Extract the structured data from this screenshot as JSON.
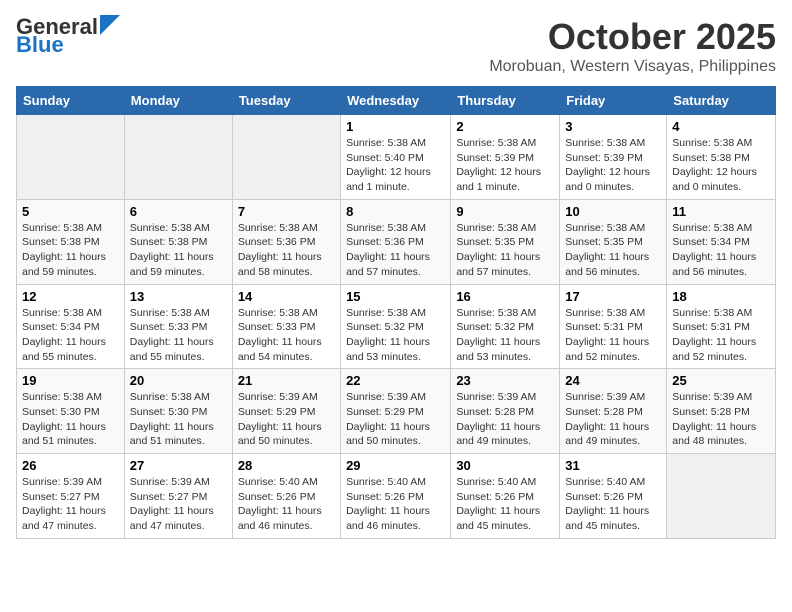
{
  "header": {
    "logo_line1": "General",
    "logo_line2": "Blue",
    "month": "October 2025",
    "location": "Morobuan, Western Visayas, Philippines"
  },
  "days_of_week": [
    "Sunday",
    "Monday",
    "Tuesday",
    "Wednesday",
    "Thursday",
    "Friday",
    "Saturday"
  ],
  "weeks": [
    [
      {
        "day": "",
        "info": ""
      },
      {
        "day": "",
        "info": ""
      },
      {
        "day": "",
        "info": ""
      },
      {
        "day": "1",
        "info": "Sunrise: 5:38 AM\nSunset: 5:40 PM\nDaylight: 12 hours and 1 minute."
      },
      {
        "day": "2",
        "info": "Sunrise: 5:38 AM\nSunset: 5:39 PM\nDaylight: 12 hours and 1 minute."
      },
      {
        "day": "3",
        "info": "Sunrise: 5:38 AM\nSunset: 5:39 PM\nDaylight: 12 hours and 0 minutes."
      },
      {
        "day": "4",
        "info": "Sunrise: 5:38 AM\nSunset: 5:38 PM\nDaylight: 12 hours and 0 minutes."
      }
    ],
    [
      {
        "day": "5",
        "info": "Sunrise: 5:38 AM\nSunset: 5:38 PM\nDaylight: 11 hours and 59 minutes."
      },
      {
        "day": "6",
        "info": "Sunrise: 5:38 AM\nSunset: 5:38 PM\nDaylight: 11 hours and 59 minutes."
      },
      {
        "day": "7",
        "info": "Sunrise: 5:38 AM\nSunset: 5:36 PM\nDaylight: 11 hours and 58 minutes."
      },
      {
        "day": "8",
        "info": "Sunrise: 5:38 AM\nSunset: 5:36 PM\nDaylight: 11 hours and 57 minutes."
      },
      {
        "day": "9",
        "info": "Sunrise: 5:38 AM\nSunset: 5:35 PM\nDaylight: 11 hours and 57 minutes."
      },
      {
        "day": "10",
        "info": "Sunrise: 5:38 AM\nSunset: 5:35 PM\nDaylight: 11 hours and 56 minutes."
      },
      {
        "day": "11",
        "info": "Sunrise: 5:38 AM\nSunset: 5:34 PM\nDaylight: 11 hours and 56 minutes."
      }
    ],
    [
      {
        "day": "12",
        "info": "Sunrise: 5:38 AM\nSunset: 5:34 PM\nDaylight: 11 hours and 55 minutes."
      },
      {
        "day": "13",
        "info": "Sunrise: 5:38 AM\nSunset: 5:33 PM\nDaylight: 11 hours and 55 minutes."
      },
      {
        "day": "14",
        "info": "Sunrise: 5:38 AM\nSunset: 5:33 PM\nDaylight: 11 hours and 54 minutes."
      },
      {
        "day": "15",
        "info": "Sunrise: 5:38 AM\nSunset: 5:32 PM\nDaylight: 11 hours and 53 minutes."
      },
      {
        "day": "16",
        "info": "Sunrise: 5:38 AM\nSunset: 5:32 PM\nDaylight: 11 hours and 53 minutes."
      },
      {
        "day": "17",
        "info": "Sunrise: 5:38 AM\nSunset: 5:31 PM\nDaylight: 11 hours and 52 minutes."
      },
      {
        "day": "18",
        "info": "Sunrise: 5:38 AM\nSunset: 5:31 PM\nDaylight: 11 hours and 52 minutes."
      }
    ],
    [
      {
        "day": "19",
        "info": "Sunrise: 5:38 AM\nSunset: 5:30 PM\nDaylight: 11 hours and 51 minutes."
      },
      {
        "day": "20",
        "info": "Sunrise: 5:38 AM\nSunset: 5:30 PM\nDaylight: 11 hours and 51 minutes."
      },
      {
        "day": "21",
        "info": "Sunrise: 5:39 AM\nSunset: 5:29 PM\nDaylight: 11 hours and 50 minutes."
      },
      {
        "day": "22",
        "info": "Sunrise: 5:39 AM\nSunset: 5:29 PM\nDaylight: 11 hours and 50 minutes."
      },
      {
        "day": "23",
        "info": "Sunrise: 5:39 AM\nSunset: 5:28 PM\nDaylight: 11 hours and 49 minutes."
      },
      {
        "day": "24",
        "info": "Sunrise: 5:39 AM\nSunset: 5:28 PM\nDaylight: 11 hours and 49 minutes."
      },
      {
        "day": "25",
        "info": "Sunrise: 5:39 AM\nSunset: 5:28 PM\nDaylight: 11 hours and 48 minutes."
      }
    ],
    [
      {
        "day": "26",
        "info": "Sunrise: 5:39 AM\nSunset: 5:27 PM\nDaylight: 11 hours and 47 minutes."
      },
      {
        "day": "27",
        "info": "Sunrise: 5:39 AM\nSunset: 5:27 PM\nDaylight: 11 hours and 47 minutes."
      },
      {
        "day": "28",
        "info": "Sunrise: 5:40 AM\nSunset: 5:26 PM\nDaylight: 11 hours and 46 minutes."
      },
      {
        "day": "29",
        "info": "Sunrise: 5:40 AM\nSunset: 5:26 PM\nDaylight: 11 hours and 46 minutes."
      },
      {
        "day": "30",
        "info": "Sunrise: 5:40 AM\nSunset: 5:26 PM\nDaylight: 11 hours and 45 minutes."
      },
      {
        "day": "31",
        "info": "Sunrise: 5:40 AM\nSunset: 5:26 PM\nDaylight: 11 hours and 45 minutes."
      },
      {
        "day": "",
        "info": ""
      }
    ]
  ]
}
